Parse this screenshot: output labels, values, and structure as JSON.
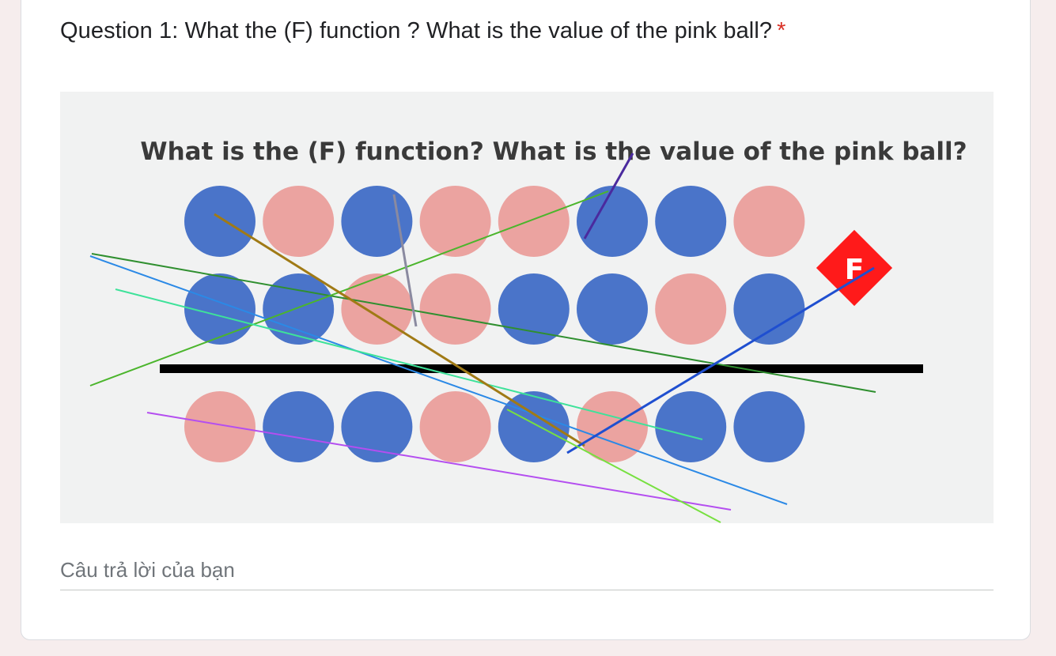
{
  "question": {
    "title": "Question 1: What the (F) function ? What is the value of the pink ball?",
    "required_marker": "*"
  },
  "image": {
    "heading": "What is the (F) function? What is the value of the pink ball?",
    "badge_label": "F",
    "ball_rows": [
      [
        "blue",
        "pink",
        "blue",
        "pink",
        "pink",
        "blue",
        "blue",
        "pink"
      ],
      [
        "blue",
        "blue",
        "pink",
        "pink",
        "blue",
        "blue",
        "pink",
        "blue"
      ],
      [
        "pink",
        "blue",
        "blue",
        "pink",
        "blue",
        "pink",
        "blue",
        "blue"
      ]
    ],
    "colors": {
      "blue": "#4a74c9",
      "pink": "#eba3a0",
      "badge": "#ff1a1a",
      "divider": "#000000",
      "image_bg": "#f1f2f2"
    }
  },
  "answer": {
    "placeholder": "Câu trả lời của bạn",
    "value": ""
  }
}
